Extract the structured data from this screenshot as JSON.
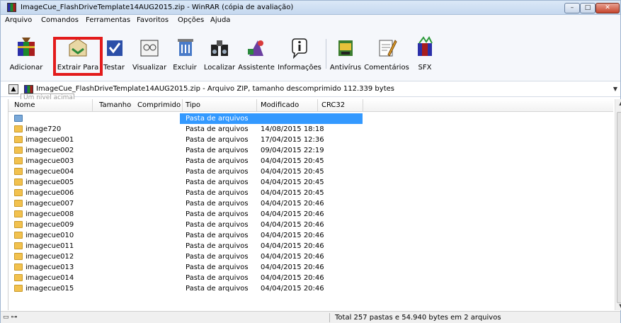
{
  "window": {
    "title": "ImageCue_FlashDriveTemplate14AUG2015.zip - WinRAR (cópia de avaliação)",
    "minimize_glyph": "–",
    "maximize_glyph": "□",
    "close_glyph": "✕"
  },
  "menu": {
    "items": [
      "Arquivo",
      "Comandos",
      "Ferramentas",
      "Favoritos",
      "Opções",
      "Ajuda"
    ]
  },
  "toolbar": {
    "buttons": [
      {
        "label": "Adicionar",
        "icon": "add-archive-icon"
      },
      {
        "label": "Extrair Para",
        "icon": "extract-to-icon"
      },
      {
        "label": "Testar",
        "icon": "test-icon"
      },
      {
        "label": "Visualizar",
        "icon": "view-icon"
      },
      {
        "label": "Excluir",
        "icon": "delete-icon"
      },
      {
        "label": "Localizar",
        "icon": "find-icon"
      },
      {
        "label": "Assistente",
        "icon": "wizard-icon"
      },
      {
        "label": "Informações",
        "icon": "info-icon"
      },
      {
        "label": "Antivírus",
        "icon": "antivirus-icon"
      },
      {
        "label": "Comentários",
        "icon": "comment-icon"
      },
      {
        "label": "SFX",
        "icon": "sfx-icon"
      }
    ],
    "highlight_color": "#e31b1b"
  },
  "address": {
    "up_glyph": "▲",
    "path": "ImageCue_FlashDriveTemplate14AUG2015.zip - Arquivo ZIP, tamanho descomprimido 112.339 bytes",
    "tooltip": "Um nível acima"
  },
  "table": {
    "columns": [
      "Nome",
      "Tamanho",
      "Comprimido",
      "Tipo",
      "Modificado",
      "CRC32"
    ],
    "rows": [
      {
        "name": "..",
        "size": "",
        "packed": "",
        "type": "Pasta de arquivos",
        "modified": "",
        "crc": "",
        "selected": true
      },
      {
        "name": "image720",
        "size": "",
        "packed": "",
        "type": "Pasta de arquivos",
        "modified": "14/08/2015 18:18",
        "crc": ""
      },
      {
        "name": "imagecue001",
        "size": "",
        "packed": "",
        "type": "Pasta de arquivos",
        "modified": "17/04/2015 12:36",
        "crc": ""
      },
      {
        "name": "imagecue002",
        "size": "",
        "packed": "",
        "type": "Pasta de arquivos",
        "modified": "09/04/2015 22:19",
        "crc": ""
      },
      {
        "name": "imagecue003",
        "size": "",
        "packed": "",
        "type": "Pasta de arquivos",
        "modified": "04/04/2015 20:45",
        "crc": ""
      },
      {
        "name": "imagecue004",
        "size": "",
        "packed": "",
        "type": "Pasta de arquivos",
        "modified": "04/04/2015 20:45",
        "crc": ""
      },
      {
        "name": "imagecue005",
        "size": "",
        "packed": "",
        "type": "Pasta de arquivos",
        "modified": "04/04/2015 20:45",
        "crc": ""
      },
      {
        "name": "imagecue006",
        "size": "",
        "packed": "",
        "type": "Pasta de arquivos",
        "modified": "04/04/2015 20:45",
        "crc": ""
      },
      {
        "name": "imagecue007",
        "size": "",
        "packed": "",
        "type": "Pasta de arquivos",
        "modified": "04/04/2015 20:46",
        "crc": ""
      },
      {
        "name": "imagecue008",
        "size": "",
        "packed": "",
        "type": "Pasta de arquivos",
        "modified": "04/04/2015 20:46",
        "crc": ""
      },
      {
        "name": "imagecue009",
        "size": "",
        "packed": "",
        "type": "Pasta de arquivos",
        "modified": "04/04/2015 20:46",
        "crc": ""
      },
      {
        "name": "imagecue010",
        "size": "",
        "packed": "",
        "type": "Pasta de arquivos",
        "modified": "04/04/2015 20:46",
        "crc": ""
      },
      {
        "name": "imagecue011",
        "size": "",
        "packed": "",
        "type": "Pasta de arquivos",
        "modified": "04/04/2015 20:46",
        "crc": ""
      },
      {
        "name": "imagecue012",
        "size": "",
        "packed": "",
        "type": "Pasta de arquivos",
        "modified": "04/04/2015 20:46",
        "crc": ""
      },
      {
        "name": "imagecue013",
        "size": "",
        "packed": "",
        "type": "Pasta de arquivos",
        "modified": "04/04/2015 20:46",
        "crc": ""
      },
      {
        "name": "imagecue014",
        "size": "",
        "packed": "",
        "type": "Pasta de arquivos",
        "modified": "04/04/2015 20:46",
        "crc": ""
      },
      {
        "name": "imagecue015",
        "size": "",
        "packed": "",
        "type": "Pasta de arquivos",
        "modified": "04/04/2015 20:46",
        "crc": ""
      }
    ],
    "selection_color": "#3399ff"
  },
  "status": {
    "icons_glyph": "▭ ⊶",
    "text": "Total 257 pastas e 54.940 bytes em 2 arquivos"
  }
}
